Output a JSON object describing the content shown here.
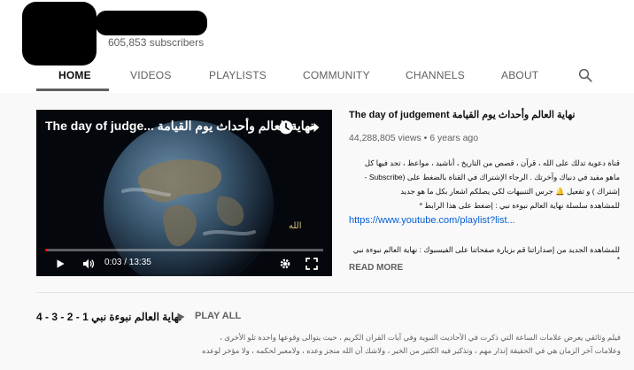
{
  "channel": {
    "subscribers": "605,853 subscribers"
  },
  "tabs": [
    {
      "label": "HOME",
      "active": true
    },
    {
      "label": "VIDEOS",
      "active": false
    },
    {
      "label": "PLAYLISTS",
      "active": false
    },
    {
      "label": "COMMUNITY",
      "active": false
    },
    {
      "label": "CHANNELS",
      "active": false
    },
    {
      "label": "ABOUT",
      "active": false
    }
  ],
  "player": {
    "overlay_title": "The day of judge... نهاية العالم وأحداث يوم القيامة",
    "time": "0:03 / 13:35",
    "progress_fraction": 0.004,
    "watermark": "الله"
  },
  "featured": {
    "title": "The day of judgement نهاية العالم وأحداث يوم القيامة",
    "meta": "44,288,805 views • 6 years ago",
    "description_lines": [
      "قناة دعوية تدلك على الله ، قرآن ، قصص من التاريخ ، أناشيد ، مواعظ ، تجد فيها كل",
      "ماهو مفيد في دنياك وآخرتك . الرجاء الإشتراك في القناة بالضغط على (Subscribe -",
      "إشتراك ) و تفعيل 🔔 جرس التنبيهات لكي يصلكم اشعار بكل ما هو جديد",
      "للمشاهدة سلسلة نهاية العالم نبوءة نبي : إضغط على هذا الرابط *"
    ],
    "link": "https://www.youtube.com/playlist?list...",
    "description_after": "للمشاهدة الجديد من إصداراتنا قم بزيارة صفحاتنا على الفيسبوك : نهاية العالم نبوءة نبي *",
    "read_more": "READ MORE"
  },
  "playlist": {
    "title": "نهاية العالم نبوءة نبي 1 - 2 - 3 - 4",
    "play_all": "PLAY ALL",
    "description_lines": [
      "فيلم وثائقي يعرض علامات الساعة التي ذكرت في الأحاديث النبوية وفي آيات القران الكريم ، حيث يتوالى وقوعها واحدة تلو الأخرى ،",
      "وعلامات آخر الزمان هي في الحقيقة إنذار مهم ، وتذكير فيه الكثير من الخير ، ولاشك أن الله منجز وعده ، ولامعبر لحكمه ، ولا مؤخر لوعده"
    ]
  },
  "colors": {
    "accent_red": "#ff0000",
    "link_blue": "#065fd4",
    "muted_text": "#606060"
  }
}
